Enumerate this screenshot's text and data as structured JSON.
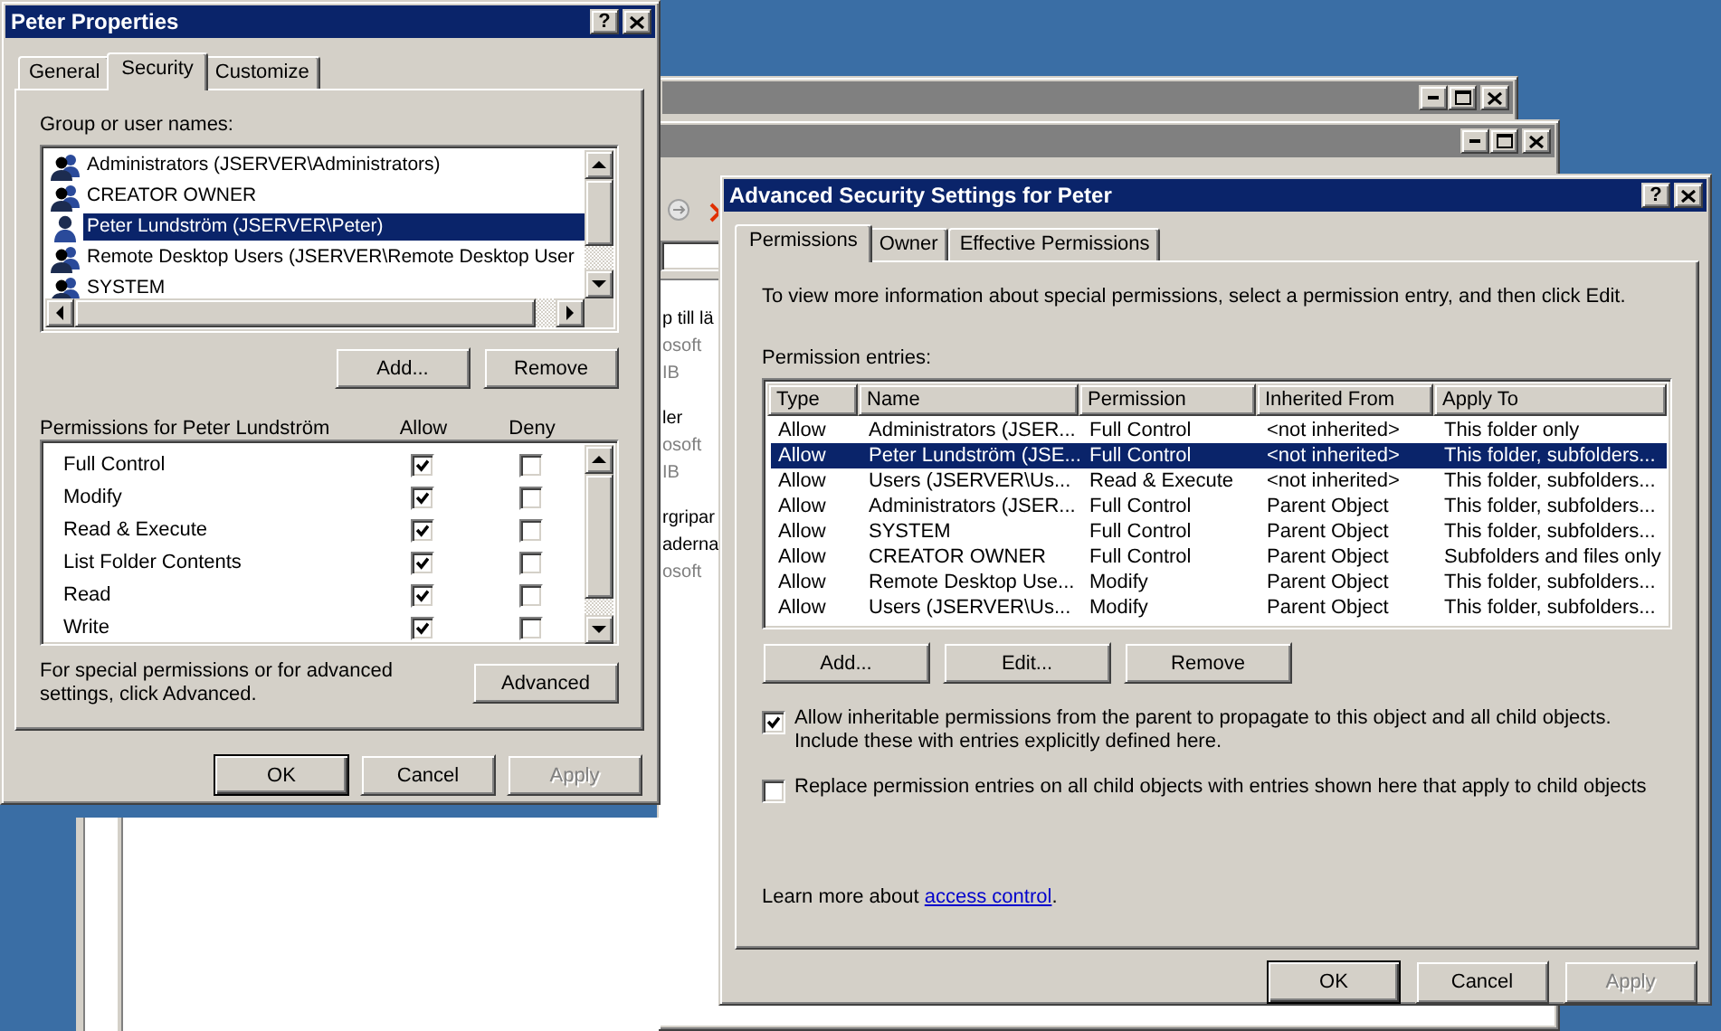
{
  "background_window": {
    "items": [
      {
        "name_lines": [
          "p till lä"
        ],
        "detail_lines": [
          "osoft",
          "IB"
        ]
      },
      {
        "name_lines": [
          "ler"
        ],
        "detail_lines": [
          "osoft",
          "IB"
        ]
      },
      {
        "name_lines": [
          "rgripar",
          "aderna"
        ],
        "detail_lines": [
          "osoft"
        ]
      }
    ]
  },
  "properties_dialog": {
    "title": "Peter Properties",
    "help_button": "?",
    "tabs": [
      {
        "label": "General",
        "selected": false
      },
      {
        "label": "Security",
        "selected": true
      },
      {
        "label": "Customize",
        "selected": false
      }
    ],
    "group_label": "Group or user names:",
    "principals": [
      {
        "name": "Administrators (JSERVER\\Administrators)",
        "kind": "group",
        "selected": false
      },
      {
        "name": "CREATOR OWNER",
        "kind": "group",
        "selected": false
      },
      {
        "name": "Peter Lundström (JSERVER\\Peter)",
        "kind": "user",
        "selected": true
      },
      {
        "name": "Remote Desktop Users (JSERVER\\Remote Desktop User",
        "kind": "group",
        "selected": false
      },
      {
        "name": "SYSTEM",
        "kind": "group",
        "selected": false
      }
    ],
    "principal_buttons": [
      {
        "label": "Add...",
        "disabled": false
      },
      {
        "label": "Remove",
        "disabled": false
      }
    ],
    "permissions_label": "Permissions for Peter Lundström",
    "allow_label": "Allow",
    "deny_label": "Deny",
    "permissions": [
      {
        "name": "Full Control",
        "allow": true,
        "deny": false
      },
      {
        "name": "Modify",
        "allow": true,
        "deny": false
      },
      {
        "name": "Read & Execute",
        "allow": true,
        "deny": false
      },
      {
        "name": "List Folder Contents",
        "allow": true,
        "deny": false
      },
      {
        "name": "Read",
        "allow": true,
        "deny": false
      },
      {
        "name": "Write",
        "allow": true,
        "deny": false
      }
    ],
    "advanced_note": "For special permissions or for advanced settings, click Advanced.",
    "advanced_button": {
      "label": "Advanced",
      "disabled": false
    },
    "footer_buttons": [
      {
        "label": "OK",
        "default": true,
        "disabled": false
      },
      {
        "label": "Cancel",
        "default": false,
        "disabled": false
      },
      {
        "label": "Apply",
        "default": false,
        "disabled": true
      }
    ]
  },
  "advanced_dialog": {
    "title": "Advanced Security Settings for Peter",
    "help_button": "?",
    "tabs": [
      {
        "label": "Permissions",
        "selected": true
      },
      {
        "label": "Owner",
        "selected": false
      },
      {
        "label": "Effective Permissions",
        "selected": false
      }
    ],
    "intro": "To view more information about special permissions, select a permission entry, and then click Edit.",
    "entries_label": "Permission entries:",
    "table": {
      "columns": [
        "Type",
        "Name",
        "Permission",
        "Inherited From",
        "Apply To"
      ],
      "rows": [
        {
          "cells": [
            "Allow",
            "Administrators (JSER...",
            "Full Control",
            "<not inherited>",
            "This folder only"
          ],
          "selected": false
        },
        {
          "cells": [
            "Allow",
            "Peter Lundström (JSE...",
            "Full Control",
            "<not inherited>",
            "This folder, subfolders..."
          ],
          "selected": true
        },
        {
          "cells": [
            "Allow",
            "Users (JSERVER\\Us...",
            "Read & Execute",
            "<not inherited>",
            "This folder, subfolders..."
          ],
          "selected": false
        },
        {
          "cells": [
            "Allow",
            "Administrators (JSER...",
            "Full Control",
            "Parent Object",
            "This folder, subfolders..."
          ],
          "selected": false
        },
        {
          "cells": [
            "Allow",
            "SYSTEM",
            "Full Control",
            "Parent Object",
            "This folder, subfolders..."
          ],
          "selected": false
        },
        {
          "cells": [
            "Allow",
            "CREATOR OWNER",
            "Full Control",
            "Parent Object",
            "Subfolders and files only"
          ],
          "selected": false
        },
        {
          "cells": [
            "Allow",
            "Remote Desktop Use...",
            "Modify",
            "Parent Object",
            "This folder, subfolders..."
          ],
          "selected": false
        },
        {
          "cells": [
            "Allow",
            "Users (JSERVER\\Us...",
            "Modify",
            "Parent Object",
            "This folder, subfolders..."
          ],
          "selected": false
        }
      ]
    },
    "entry_buttons": [
      {
        "label": "Add...",
        "disabled": false
      },
      {
        "label": "Edit...",
        "disabled": false
      },
      {
        "label": "Remove",
        "disabled": false
      }
    ],
    "options": [
      {
        "label": "Allow inheritable permissions from the parent to propagate to this object and all child objects. Include these with entries explicitly defined here.",
        "checked": true
      },
      {
        "label": "Replace permission entries on all child objects with entries shown here that apply to child objects",
        "checked": false
      }
    ],
    "learn_more": {
      "text": "Learn more about ",
      "link": "access control",
      "suffix": "."
    },
    "footer_buttons": [
      {
        "label": "OK",
        "default": true,
        "disabled": false
      },
      {
        "label": "Cancel",
        "default": false,
        "disabled": false
      },
      {
        "label": "Apply",
        "default": false,
        "disabled": true
      }
    ]
  }
}
